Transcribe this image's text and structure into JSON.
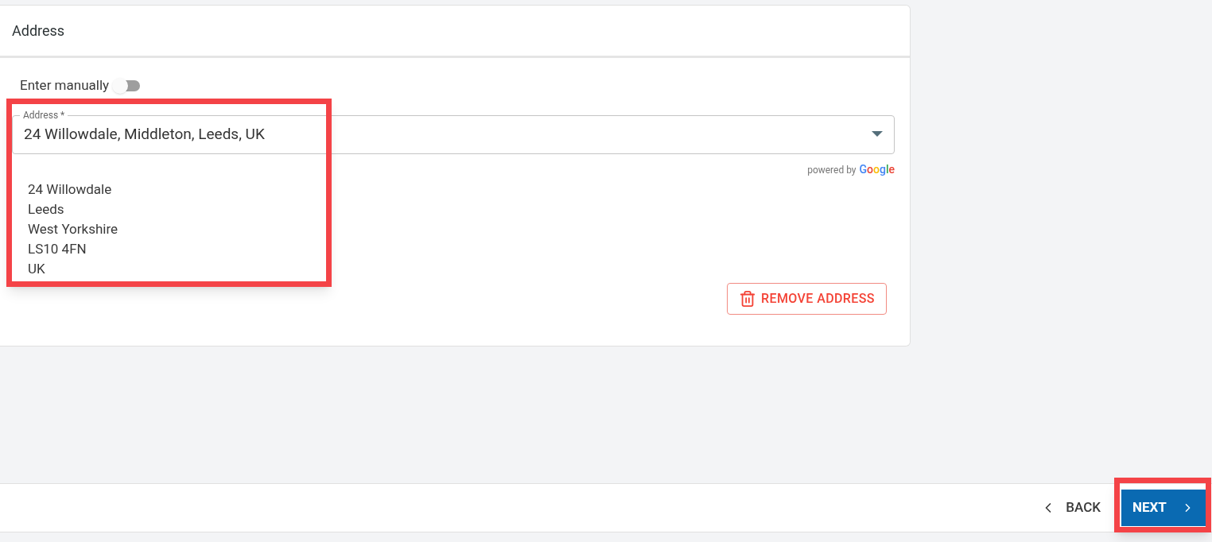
{
  "card": {
    "title": "Address",
    "toggle": {
      "label": "Enter manually",
      "on": false
    },
    "address_field": {
      "label": "Address *",
      "value": "24 Willowdale, Middleton, Leeds, UK"
    },
    "attribution": {
      "text": "powered by",
      "brand": "Google"
    },
    "address_lines": [
      "24 Willowdale",
      "Leeds",
      "West Yorkshire",
      "LS10 4FN",
      "UK"
    ],
    "remove_button": "REMOVE ADDRESS"
  },
  "footer": {
    "back": "BACK",
    "next": "NEXT"
  }
}
